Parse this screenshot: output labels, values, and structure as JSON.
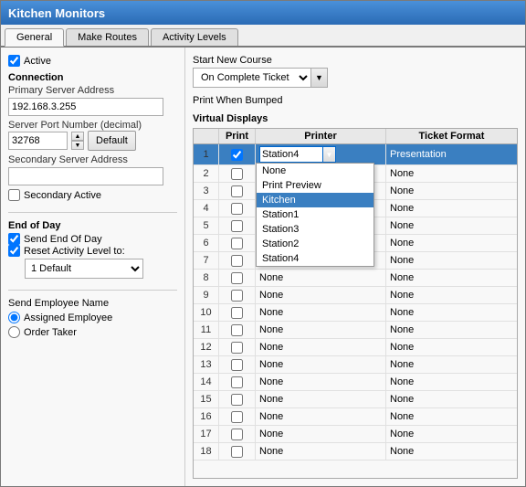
{
  "window": {
    "title": "Kitchen Monitors"
  },
  "tabs": [
    {
      "label": "General",
      "active": true
    },
    {
      "label": "Make Routes",
      "active": false
    },
    {
      "label": "Activity Levels",
      "active": false
    }
  ],
  "left": {
    "active_label": "Active",
    "connection_label": "Connection",
    "primary_server_label": "Primary Server Address",
    "primary_server_value": "192.168.3.255",
    "server_port_label": "Server Port Number (decimal)",
    "server_port_value": "32768",
    "default_btn": "Default",
    "secondary_server_label": "Secondary Server Address",
    "secondary_server_value": "",
    "secondary_active_label": "Secondary Active",
    "end_of_day_label": "End of Day",
    "send_end_of_day_label": "Send End Of Day",
    "reset_activity_label": "Reset Activity Level to:",
    "activity_dropdown": "1 Default",
    "send_employee_label": "Send Employee Name",
    "assigned_employee_label": "Assigned Employee",
    "order_taker_label": "Order Taker"
  },
  "right": {
    "start_new_course_label": "Start New Course",
    "start_dropdown_value": "On Complete Ticket",
    "print_when_bumped_label": "Print When Bumped",
    "virtual_displays_label": "Virtual Displays",
    "table": {
      "headers": [
        "",
        "Print",
        "Printer",
        "Ticket Format"
      ],
      "rows": [
        {
          "num": "1",
          "print": true,
          "printer": "Station4",
          "ticket_format": "Presentation",
          "selected": true
        },
        {
          "num": "2",
          "print": false,
          "printer": "None",
          "ticket_format": "None"
        },
        {
          "num": "3",
          "print": false,
          "printer": "None",
          "ticket_format": "None"
        },
        {
          "num": "4",
          "print": false,
          "printer": "None",
          "ticket_format": "None"
        },
        {
          "num": "5",
          "print": false,
          "printer": "None",
          "ticket_format": "None"
        },
        {
          "num": "6",
          "print": false,
          "printer": "None",
          "ticket_format": "None"
        },
        {
          "num": "7",
          "print": false,
          "printer": "None",
          "ticket_format": "None"
        },
        {
          "num": "8",
          "print": false,
          "printer": "None",
          "ticket_format": "None"
        },
        {
          "num": "9",
          "print": false,
          "printer": "None",
          "ticket_format": "None"
        },
        {
          "num": "10",
          "print": false,
          "printer": "None",
          "ticket_format": "None"
        },
        {
          "num": "11",
          "print": false,
          "printer": "None",
          "ticket_format": "None"
        },
        {
          "num": "12",
          "print": false,
          "printer": "None",
          "ticket_format": "None"
        },
        {
          "num": "13",
          "print": false,
          "printer": "None",
          "ticket_format": "None"
        },
        {
          "num": "14",
          "print": false,
          "printer": "None",
          "ticket_format": "None"
        },
        {
          "num": "15",
          "print": false,
          "printer": "None",
          "ticket_format": "None"
        },
        {
          "num": "16",
          "print": false,
          "printer": "None",
          "ticket_format": "None"
        },
        {
          "num": "17",
          "print": false,
          "printer": "None",
          "ticket_format": "None"
        },
        {
          "num": "18",
          "print": false,
          "printer": "None",
          "ticket_format": "None"
        }
      ]
    },
    "printer_dropdown_items": [
      "None",
      "Print Preview",
      "Kitchen",
      "Station1",
      "Station3",
      "Station2",
      "Station4"
    ]
  }
}
